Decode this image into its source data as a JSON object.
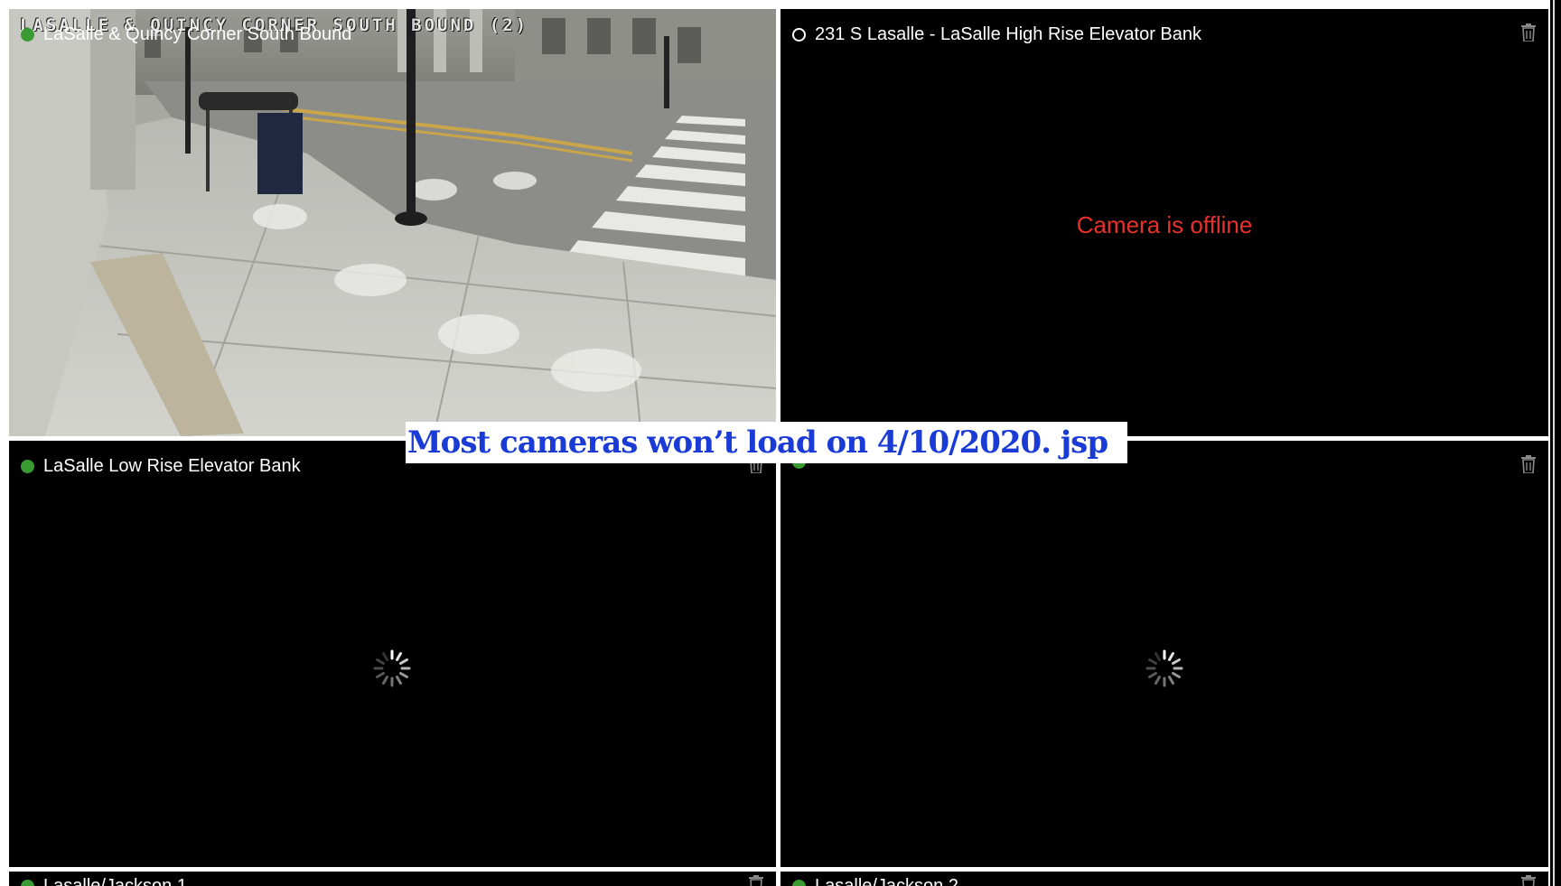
{
  "tiles": [
    {
      "title": "LaSalle & Quincy Corner South Bound",
      "status": "online",
      "osd_text": "LASALLE & QUINCY CORNER SOUTH BOUND (2)",
      "state": "live"
    },
    {
      "title": "231 S Lasalle - LaSalle High Rise Elevator Bank",
      "status": "offline",
      "message": "Camera is offline",
      "state": "offline"
    },
    {
      "title": "LaSalle Low Rise Elevator Bank",
      "status": "online",
      "state": "loading"
    },
    {
      "title": "",
      "status": "online",
      "state": "loading"
    },
    {
      "title": "Lasalle/Jackson 1",
      "status": "online",
      "state": "loading"
    },
    {
      "title": "Lasalle/Jackson 2",
      "status": "online",
      "state": "loading"
    }
  ],
  "annotation": "Most cameras won’t load on 4/10/2020.  jsp",
  "colors": {
    "online": "#3a9b32",
    "offline_text": "#e8312c",
    "annotation_text": "#1a3bd6"
  },
  "icons": {
    "delete": "trash-icon",
    "loading": "spinner-icon"
  }
}
